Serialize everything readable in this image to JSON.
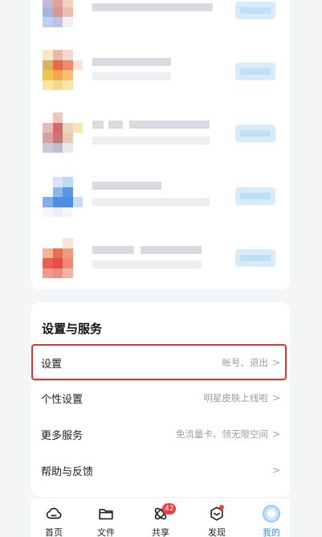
{
  "settings": {
    "section_title": "设置与服务",
    "rows": [
      {
        "label": "设置",
        "value": "帐号、退出",
        "chevron": ">"
      },
      {
        "label": "个性设置",
        "value": "明星皮肤上线啦",
        "chevron": ">"
      },
      {
        "label": "更多服务",
        "value": "免流量卡、领无限空间",
        "chevron": ">"
      },
      {
        "label": "帮助与反馈",
        "value": "",
        "chevron": ">"
      }
    ]
  },
  "tabbar": {
    "tabs": [
      {
        "label": "首页",
        "icon": "cloud-home-icon"
      },
      {
        "label": "文件",
        "icon": "folder-icon"
      },
      {
        "label": "共享",
        "icon": "share-atom-icon",
        "badge": "42"
      },
      {
        "label": "发现",
        "icon": "discover-cube-icon",
        "dot": true
      },
      {
        "label": "我的",
        "icon": "avatar-icon",
        "active": true
      }
    ],
    "active_color": "#3a8df7",
    "badge_color": "#f04141"
  }
}
